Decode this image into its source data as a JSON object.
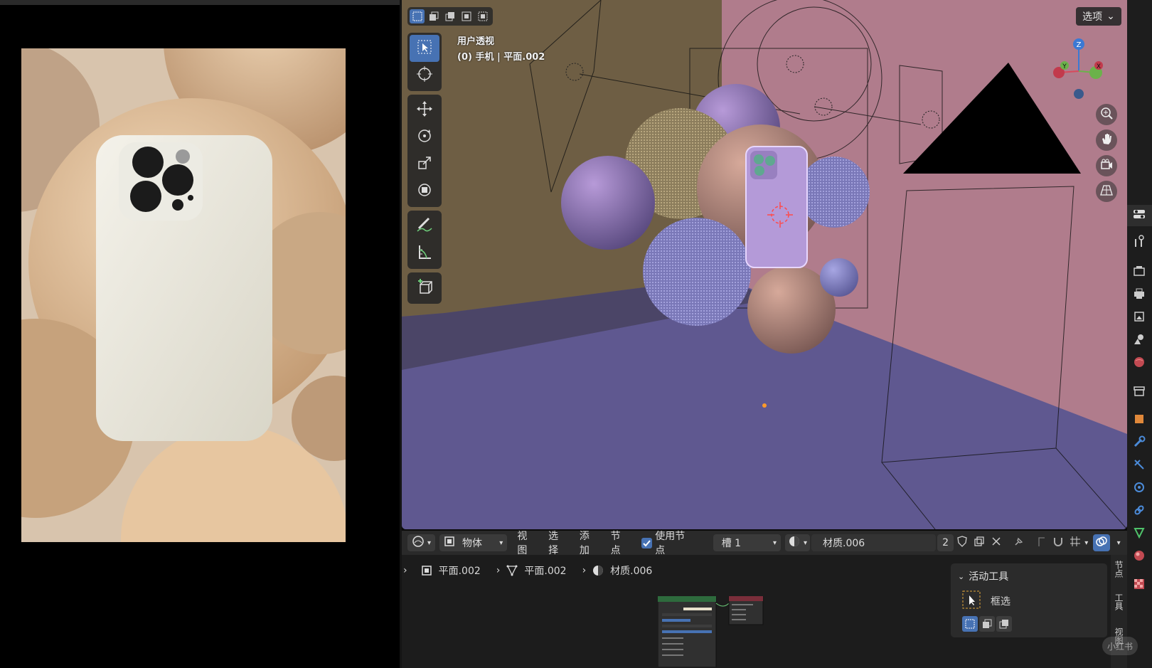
{
  "viewport": {
    "view_name": "用户透视",
    "active_object": "(0) 手机 | 平面.002",
    "options_label": "选项",
    "gizmo_axes": {
      "z": "Z",
      "y": "Y",
      "x": "X"
    }
  },
  "node_editor": {
    "header": {
      "editor_type_icon": "node-editor-icon",
      "mode": "物体",
      "menus": [
        "视图",
        "选择",
        "添加",
        "节点"
      ],
      "use_nodes_label": "使用节点",
      "use_nodes_checked": true,
      "slot": "槽 1",
      "material": "材质.006",
      "user_count": "2"
    },
    "breadcrumb": [
      "平面.002",
      "平面.002",
      "材质.006"
    ],
    "side_panel": {
      "title": "活动工具",
      "tool_name": "框选"
    },
    "tabs": [
      "节点",
      "工具",
      "视图"
    ]
  },
  "watermark": "小红书",
  "colors": {
    "accent": "#4772b3",
    "floor": "#5f5890",
    "back_wall": "#b07c8c",
    "side_wall": "#6e5e44"
  }
}
